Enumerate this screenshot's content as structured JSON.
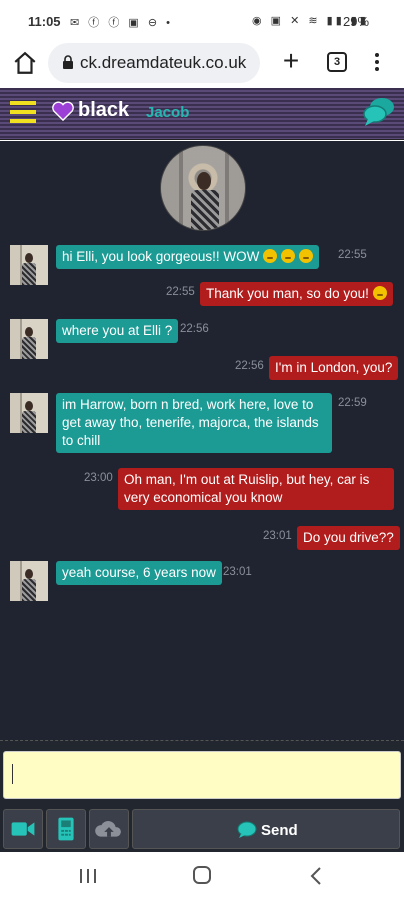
{
  "status_bar": {
    "time": "11:05",
    "battery": "29%",
    "left_icons": "✉ ⓕ ⓕ ▣ ⊖ •",
    "right_icons": "◉ ▣ ✕ ≋ ▮▮ ▮▮"
  },
  "browser": {
    "url": "ck.dreamdateuk.co.uk",
    "tab_count": "3"
  },
  "app_header": {
    "brand": "black",
    "partner_name": "Jacob"
  },
  "messages": [
    {
      "dir": "in",
      "text": "hi Elli, you look gorgeous!! WOW",
      "time": "22:55",
      "emojis": 3
    },
    {
      "dir": "out",
      "text": "Thank you man, so do you!",
      "time": "22:55",
      "emojis": 1
    },
    {
      "dir": "in",
      "text": "where you at Elli ?",
      "time": "22:56",
      "emojis": 0
    },
    {
      "dir": "out",
      "text": "I'm in London, you?",
      "time": "22:56",
      "emojis": 0
    },
    {
      "dir": "in",
      "text": "im Harrow, born n bred, work here, love to get away tho, tenerife, majorca, the islands to chill",
      "time": "22:59",
      "emojis": 0
    },
    {
      "dir": "out",
      "text": "Oh man, I'm out at Ruislip, but hey, car is very economical you know",
      "time": "23:00",
      "emojis": 0
    },
    {
      "dir": "out",
      "text": "Do you drive??",
      "time": "23:01",
      "emojis": 0
    },
    {
      "dir": "in",
      "text": "yeah course, 6 years now",
      "time": "23:01",
      "emojis": 0
    }
  ],
  "composer": {
    "value": "",
    "send_label": "Send"
  },
  "colors": {
    "incoming_bubble": "#1c9a94",
    "outgoing_bubble": "#b11c1c",
    "chat_background": "#1f2430",
    "input_background": "#fffcc4",
    "accent_teal": "#26b8b0",
    "hamburger_yellow": "#f0e020",
    "heart_purple": "#9b3fd6"
  },
  "icons": [
    "home-icon",
    "lock-icon",
    "plus-icon",
    "tabs-icon",
    "more-vert-icon",
    "hamburger-icon",
    "heart-icon",
    "chat-bubbles-icon",
    "video-camera-icon",
    "phone-icon",
    "cloud-upload-icon",
    "send-chat-icon",
    "nav-recent-icon",
    "nav-home-icon",
    "nav-back-icon"
  ]
}
